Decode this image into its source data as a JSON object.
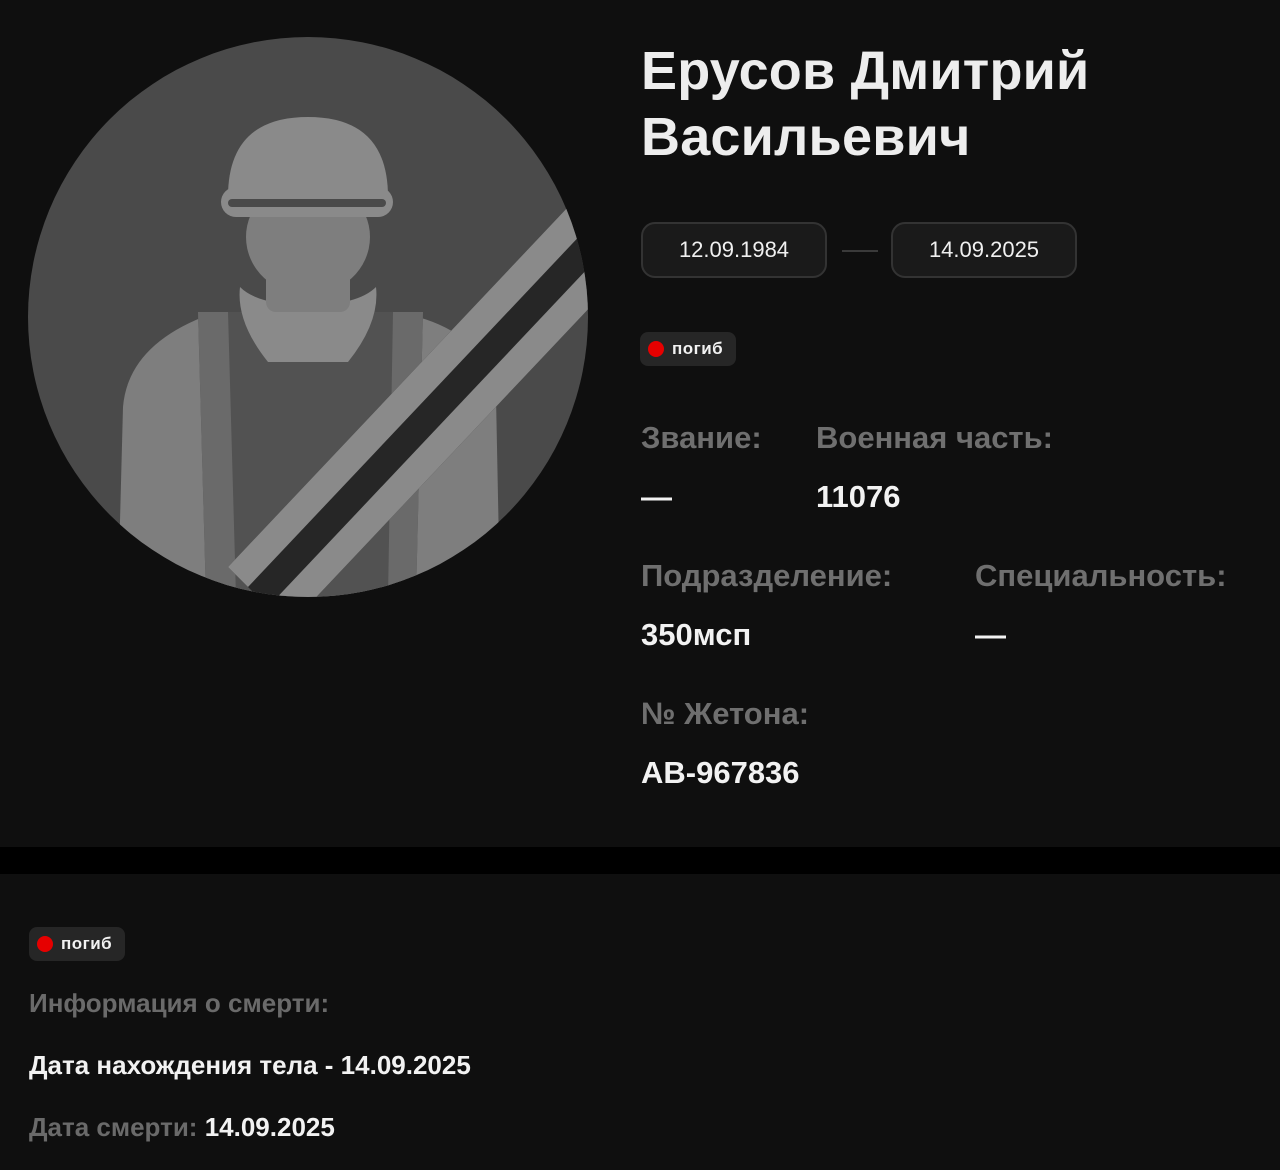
{
  "profile": {
    "name_line1": "Ерусов Дмитрий",
    "name_line2": "Васильевич",
    "birth_date": "12.09.1984",
    "death_date": "14.09.2025",
    "status_badge": "погиб",
    "status_color": "#e60000"
  },
  "fields": {
    "rank_label": "Звание:",
    "rank_value": "—",
    "unit_label": "Военная часть:",
    "unit_value": "11076",
    "division_label": "Подразделение:",
    "division_value": "350мсп",
    "specialty_label": "Специальность:",
    "specialty_value": "—",
    "token_label": "№ Жетона:",
    "token_value": "АВ-967836"
  },
  "death_info": {
    "status_badge": "погиб",
    "heading": "Информация о смерти:",
    "body_found": "Дата нахождения тела - 14.09.2025",
    "death_date_label": "Дата смерти:",
    "death_date_value": "14.09.2025"
  },
  "avatar": {
    "icon": "soldier-silhouette-icon",
    "mourning_ribbon": true
  }
}
